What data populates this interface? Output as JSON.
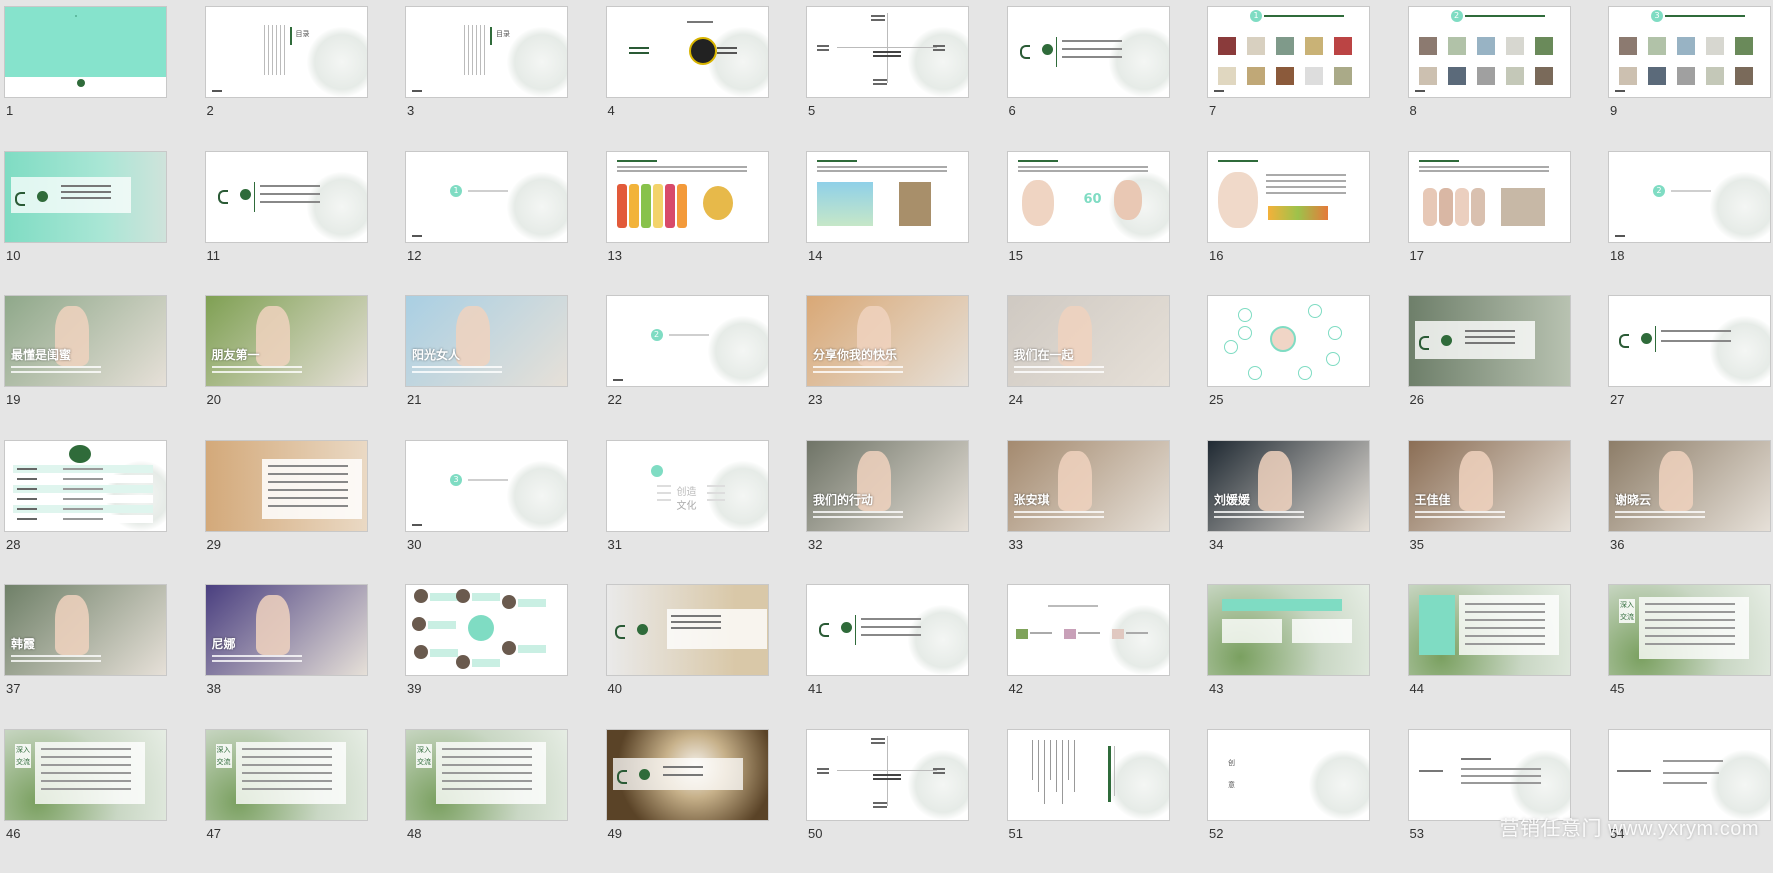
{
  "watermark": "营销任意门 www.yxrym.com",
  "slides": [
    {
      "n": "1",
      "kind": "cover-teal",
      "bg": "#86e3cc"
    },
    {
      "n": "2",
      "kind": "toc-white",
      "title": "目录"
    },
    {
      "n": "3",
      "kind": "toc-white",
      "title": "目录"
    },
    {
      "n": "4",
      "kind": "brand-circle"
    },
    {
      "n": "5",
      "kind": "tree"
    },
    {
      "n": "6",
      "kind": "brand-list"
    },
    {
      "n": "7",
      "kind": "products",
      "badge": "1"
    },
    {
      "n": "8",
      "kind": "products-photos",
      "badge": "2"
    },
    {
      "n": "9",
      "kind": "products-photos",
      "badge": "3"
    },
    {
      "n": "10",
      "kind": "teal-photo"
    },
    {
      "n": "11",
      "kind": "brand-list"
    },
    {
      "n": "12",
      "kind": "section",
      "badge": "1"
    },
    {
      "n": "13",
      "kind": "content-fruits"
    },
    {
      "n": "14",
      "kind": "content-photos"
    },
    {
      "n": "15",
      "kind": "content-face",
      "text": "60"
    },
    {
      "n": "16",
      "kind": "content-face2"
    },
    {
      "n": "17",
      "kind": "content-girls"
    },
    {
      "n": "18",
      "kind": "section",
      "badge": "2"
    },
    {
      "n": "19",
      "kind": "photo",
      "bg": "#8fa88a",
      "title": "最懂是闺蜜"
    },
    {
      "n": "20",
      "kind": "photo",
      "bg": "#7fa053",
      "title": "朋友第一"
    },
    {
      "n": "21",
      "kind": "photo",
      "bg": "#a9cfe3",
      "title": "阳光女人"
    },
    {
      "n": "22",
      "kind": "section",
      "badge": "2"
    },
    {
      "n": "23",
      "kind": "photo",
      "bg": "#d9a876",
      "title": "分享你我的快乐"
    },
    {
      "n": "24",
      "kind": "photo",
      "bg": "#cfc9c2",
      "title": "我们在一起"
    },
    {
      "n": "25",
      "kind": "mindmap"
    },
    {
      "n": "26",
      "kind": "brand-photo"
    },
    {
      "n": "27",
      "kind": "brand-line"
    },
    {
      "n": "28",
      "kind": "table"
    },
    {
      "n": "29",
      "kind": "photo-text",
      "bg": "#c99e73"
    },
    {
      "n": "30",
      "kind": "section",
      "badge": "3"
    },
    {
      "n": "31",
      "kind": "wordcloud",
      "w1": "创造",
      "w2": "文化"
    },
    {
      "n": "32",
      "kind": "photo",
      "bg": "#6f7467",
      "title": "我们的行动"
    },
    {
      "n": "33",
      "kind": "photo",
      "bg": "#a48a6f",
      "title": "张安琪"
    },
    {
      "n": "34",
      "kind": "photo",
      "bg": "#202a33",
      "title": "刘媛媛"
    },
    {
      "n": "35",
      "kind": "photo",
      "bg": "#8b6e55",
      "title": "王佳佳"
    },
    {
      "n": "36",
      "kind": "photo",
      "bg": "#8d7d68",
      "title": "谢晓云"
    },
    {
      "n": "37",
      "kind": "photo",
      "bg": "#6f8068",
      "title": "韩霞"
    },
    {
      "n": "38",
      "kind": "photo",
      "bg": "#4a3f80",
      "title": "尼娜"
    },
    {
      "n": "39",
      "kind": "circles"
    },
    {
      "n": "40",
      "kind": "brand-photo2"
    },
    {
      "n": "41",
      "kind": "brand-list"
    },
    {
      "n": "42",
      "kind": "three-img"
    },
    {
      "n": "43",
      "kind": "green-leaf"
    },
    {
      "n": "44",
      "kind": "green-leaf2"
    },
    {
      "n": "45",
      "kind": "green-leaf3",
      "vert": "深入交流"
    },
    {
      "n": "46",
      "kind": "green-leaf3",
      "vert": "深入交流"
    },
    {
      "n": "47",
      "kind": "green-leaf3",
      "vert": "深入交流"
    },
    {
      "n": "48",
      "kind": "green-leaf3",
      "vert": "深入交流"
    },
    {
      "n": "49",
      "kind": "brand-flower"
    },
    {
      "n": "50",
      "kind": "tree"
    },
    {
      "n": "51",
      "kind": "vertical-text"
    },
    {
      "n": "52",
      "kind": "end",
      "title": "创意"
    },
    {
      "n": "53",
      "kind": "text-lines"
    },
    {
      "n": "54",
      "kind": "text-lines2"
    }
  ]
}
